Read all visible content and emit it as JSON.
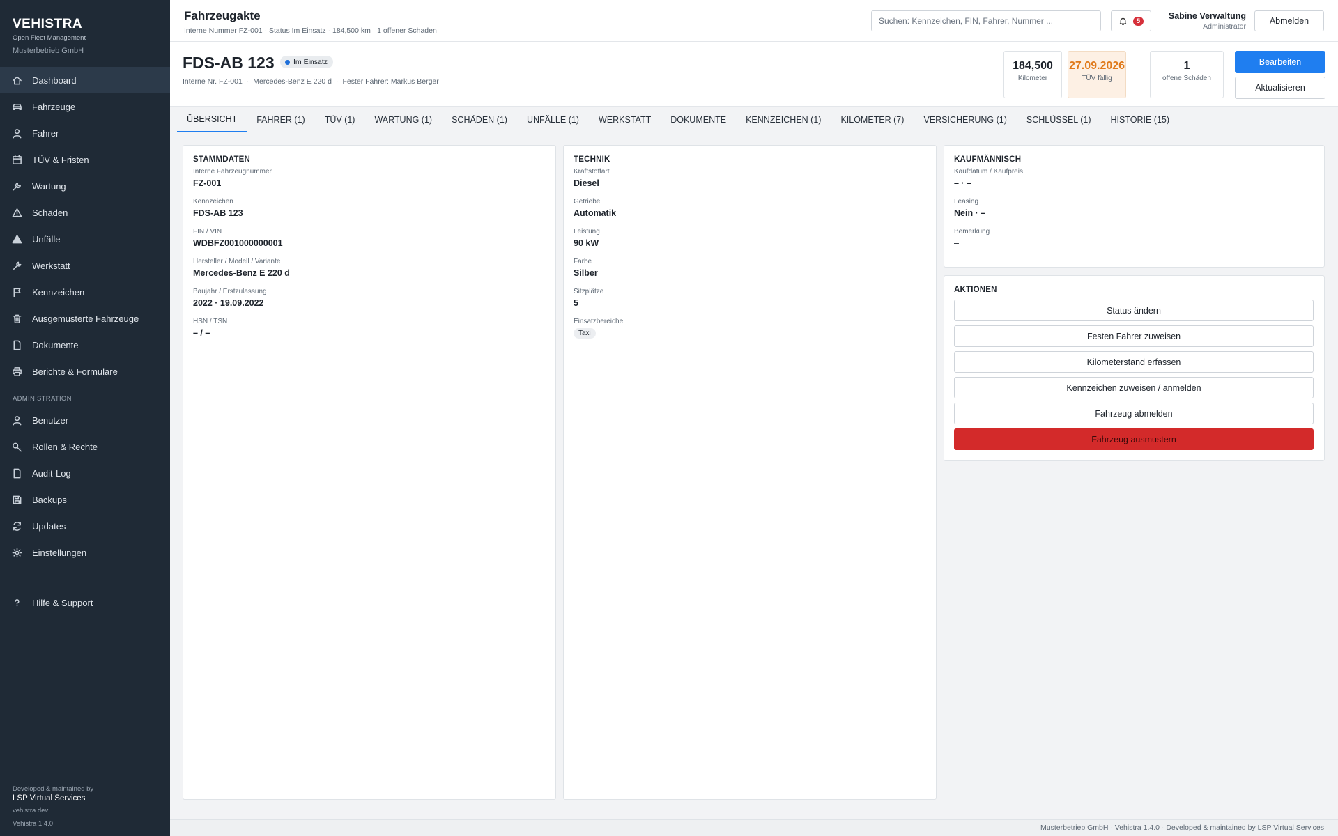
{
  "brand": {
    "name": "VEHISTRA",
    "tagline": "Open Fleet Management",
    "org": "Musterbetrieb GmbH"
  },
  "sidebar": {
    "items": [
      {
        "label": "Dashboard",
        "icon": "home-icon",
        "active": true
      },
      {
        "label": "Fahrzeuge",
        "icon": "car-icon"
      },
      {
        "label": "Fahrer",
        "icon": "user-icon"
      },
      {
        "label": "TÜV & Fristen",
        "icon": "calendar-icon"
      },
      {
        "label": "Wartung",
        "icon": "wrench-icon"
      },
      {
        "label": "Schäden",
        "icon": "warning-icon"
      },
      {
        "label": "Unfälle",
        "icon": "alert-filled-icon"
      },
      {
        "label": "Werkstatt",
        "icon": "tool-icon"
      },
      {
        "label": "Kennzeichen",
        "icon": "flag-icon"
      },
      {
        "label": "Ausgemusterte Fahrzeuge",
        "icon": "trash-icon"
      },
      {
        "label": "Dokumente",
        "icon": "document-icon"
      },
      {
        "label": "Berichte & Formulare",
        "icon": "printer-icon"
      }
    ],
    "admin_section": "ADMINISTRATION",
    "admin_items": [
      {
        "label": "Benutzer",
        "icon": "user-icon"
      },
      {
        "label": "Rollen & Rechte",
        "icon": "key-icon"
      },
      {
        "label": "Audit-Log",
        "icon": "document-icon"
      },
      {
        "label": "Backups",
        "icon": "save-icon"
      },
      {
        "label": "Updates",
        "icon": "refresh-icon"
      },
      {
        "label": "Einstellungen",
        "icon": "gear-icon"
      }
    ],
    "help": {
      "label": "Hilfe & Support",
      "icon": "help-icon"
    },
    "footer": {
      "line1": "Developed & maintained by",
      "company": "LSP Virtual Services",
      "site": "vehistra.dev",
      "version": "Vehistra 1.4.0"
    }
  },
  "topbar": {
    "title": "Fahrzeugakte",
    "subtitle": "Interne Nummer FZ-001 · Status Im Einsatz · 184,500 km · 1 offener Schaden",
    "search_placeholder": "Suchen: Kennzeichen, FIN, Fahrer, Nummer ...",
    "notifications": "5",
    "user_name": "Sabine Verwaltung",
    "user_role": "Administrator",
    "logout": "Abmelden"
  },
  "vehicle": {
    "plate": "FDS-AB 123",
    "status": "Im Einsatz",
    "status_color": "#1e6fd9",
    "meta": [
      "Interne Nr. FZ-001",
      "·",
      "Mercedes-Benz E 220 d",
      "·",
      "Fester Fahrer: Markus Berger"
    ],
    "kpis": [
      {
        "value": "184,500",
        "label": "Kilometer"
      },
      {
        "value": "27.09.2026",
        "label": "TÜV fällig",
        "color": "#e07a1b"
      },
      {
        "value": "1",
        "label": "offene Schäden"
      }
    ],
    "edit": "Bearbeiten",
    "refresh": "Aktualisieren"
  },
  "tabs": [
    "ÜBERSICHT",
    "FAHRER (1)",
    "TÜV (1)",
    "WARTUNG (1)",
    "SCHÄDEN (1)",
    "UNFÄLLE (1)",
    "WERKSTATT",
    "DOKUMENTE",
    "KENNZEICHEN (1)",
    "KILOMETER (7)",
    "VERSICHERUNG (1)",
    "SCHLÜSSEL (1)",
    "HISTORIE (15)"
  ],
  "stammdaten": {
    "title": "STAMMDATEN",
    "fields": [
      {
        "label": "Interne Fahrzeugnummer",
        "value": "FZ-001"
      },
      {
        "label": "Kennzeichen",
        "value": "FDS-AB 123"
      },
      {
        "label": "FIN / VIN",
        "value": "WDBFZ001000000001"
      },
      {
        "label": "Hersteller / Modell / Variante",
        "value": "Mercedes-Benz E 220 d"
      },
      {
        "label": "Baujahr / Erstzulassung",
        "value": "2022 · 19.09.2022"
      },
      {
        "label": "HSN / TSN",
        "value": "– / –"
      }
    ]
  },
  "technik": {
    "title": "TECHNIK",
    "fields": [
      {
        "label": "Kraftstoffart",
        "value": "Diesel"
      },
      {
        "label": "Getriebe",
        "value": "Automatik"
      },
      {
        "label": "Leistung",
        "value": "90 kW"
      },
      {
        "label": "Farbe",
        "value": "Silber"
      },
      {
        "label": "Sitzplätze",
        "value": "5"
      }
    ],
    "einsatz_label": "Einsatzbereiche",
    "einsatz_chip": "Taxi"
  },
  "kaufmaennisch": {
    "title": "KAUFMÄNNISCH",
    "fields": [
      {
        "label": "Kaufdatum / Kaufpreis",
        "value": "– · –"
      },
      {
        "label": "Leasing",
        "value": "Nein · –"
      },
      {
        "label": "Bemerkung",
        "value": "–"
      }
    ]
  },
  "aktionen": {
    "title": "AKTIONEN",
    "buttons": [
      "Status ändern",
      "Festen Fahrer zuweisen",
      "Kilometerstand erfassen",
      "Kennzeichen zuweisen / anmelden",
      "Fahrzeug abmelden"
    ],
    "danger": "Fahrzeug ausmustern",
    "danger_color": "#d32a2a"
  },
  "footer": "Musterbetrieb GmbH · Vehistra 1.4.0 · Developed & maintained by LSP Virtual Services"
}
